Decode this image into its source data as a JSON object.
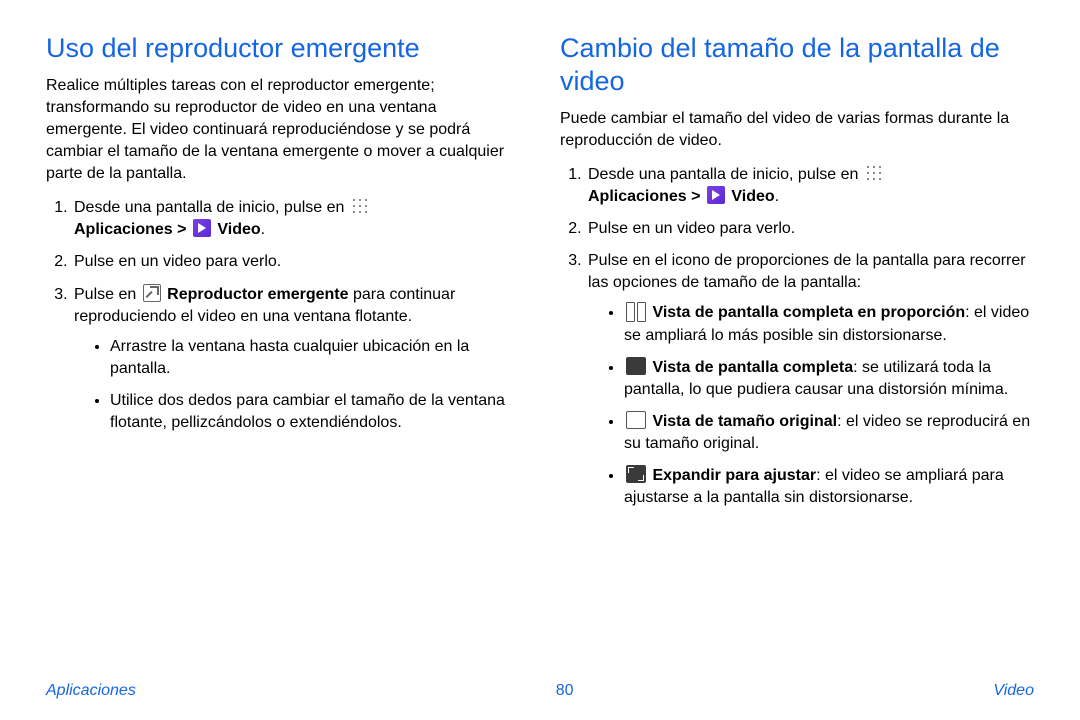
{
  "left": {
    "heading": "Uso del reproductor emergente",
    "intro": "Realice múltiples tareas con el reproductor emergente; transformando su reproductor de video en una ventana emergente. El video continuará reproduciéndose y se podrá cambiar el tamaño de la ventana emergente o mover a cualquier parte de la pantalla.",
    "step1_pre": "Desde una pantalla de inicio, pulse en ",
    "step1_apps": "Aplicaciones > ",
    "step1_video": " Video",
    "step1_post": ".",
    "step2": "Pulse en un video para verlo.",
    "step3_pre": "Pulse en ",
    "step3_bold": " Reproductor emergente",
    "step3_post": " para continuar reproduciendo el video en una ventana flotante.",
    "bullet1": "Arrastre la ventana hasta cualquier ubicación en la pantalla.",
    "bullet2": "Utilice dos dedos para cambiar el tamaño de la ventana flotante, pellizcándolos o extendiéndolos."
  },
  "right": {
    "heading": "Cambio del tamaño de la pantalla de video",
    "intro": "Puede cambiar el tamaño del video de varias formas durante la reproducción de video.",
    "step1_pre": "Desde una pantalla de inicio, pulse en ",
    "step1_apps": "Aplicaciones > ",
    "step1_video": " Video",
    "step1_post": ".",
    "step2": "Pulse en un video para verlo.",
    "step3": "Pulse en el icono de proporciones de la pantalla para recorrer las opciones de tamaño de la pantalla:",
    "b1_bold": " Vista de pantalla completa en proporción",
    "b1_rest": ": el video se ampliará lo más posible sin distorsionarse.",
    "b2_bold": " Vista de pantalla completa",
    "b2_rest": ": se utilizará toda la pantalla, lo que pudiera causar una distorsión mínima.",
    "b3_bold": " Vista de tamaño original",
    "b3_rest": ": el video se reproducirá en su tamaño original.",
    "b4_bold": " Expandir para ajustar",
    "b4_rest": ": el video se ampliará para ajustarse a la pantalla sin distorsionarse."
  },
  "footer": {
    "left": "Aplicaciones",
    "page": "80",
    "right": "Video"
  }
}
